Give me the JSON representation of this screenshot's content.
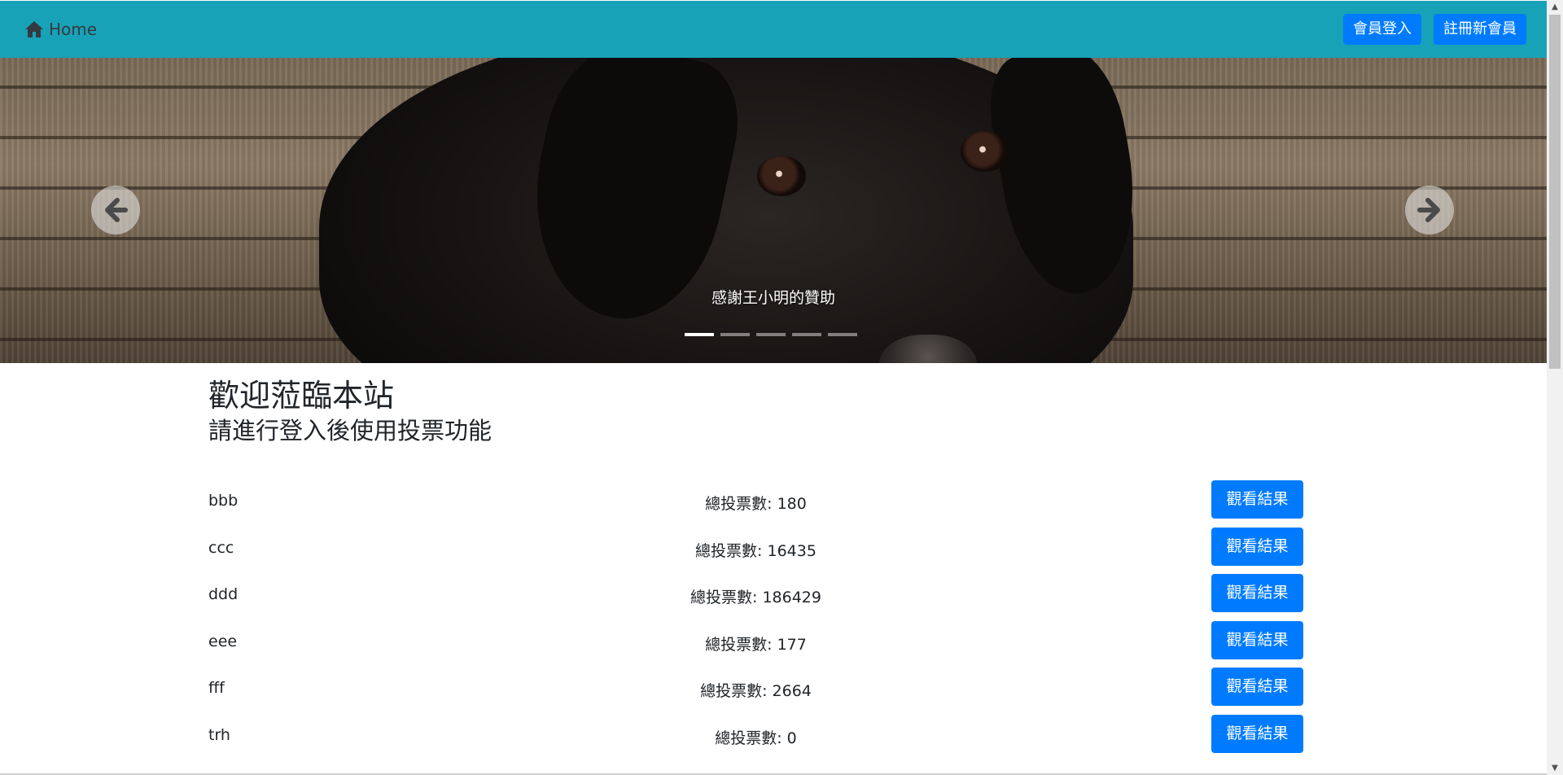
{
  "navbar": {
    "brand_label": "Home",
    "brand_icon": "home-icon",
    "login_label": "會員登入",
    "register_label": "註冊新會員",
    "bg_color": "#17a2b8"
  },
  "carousel": {
    "caption": "感謝王小明的贊助",
    "slide_count": 5,
    "active_index": 0,
    "prev_icon": "arrow-left-icon",
    "next_icon": "arrow-right-icon"
  },
  "main": {
    "welcome": "歡迎蒞臨本站",
    "subtitle": "請進行登入後使用投票功能"
  },
  "polls": [
    {
      "name": "bbb",
      "count_text": "總投票數: 180",
      "button_label": "觀看結果"
    },
    {
      "name": "ccc",
      "count_text": "總投票數: 16435",
      "button_label": "觀看結果"
    },
    {
      "name": "ddd",
      "count_text": "總投票數: 186429",
      "button_label": "觀看結果"
    },
    {
      "name": "eee",
      "count_text": "總投票數: 177",
      "button_label": "觀看結果"
    },
    {
      "name": "fff",
      "count_text": "總投票數: 2664",
      "button_label": "觀看結果"
    },
    {
      "name": "trh",
      "count_text": "總投票數: 0",
      "button_label": "觀看結果"
    }
  ],
  "colors": {
    "primary": "#007bff",
    "navbar": "#17a2b8"
  }
}
